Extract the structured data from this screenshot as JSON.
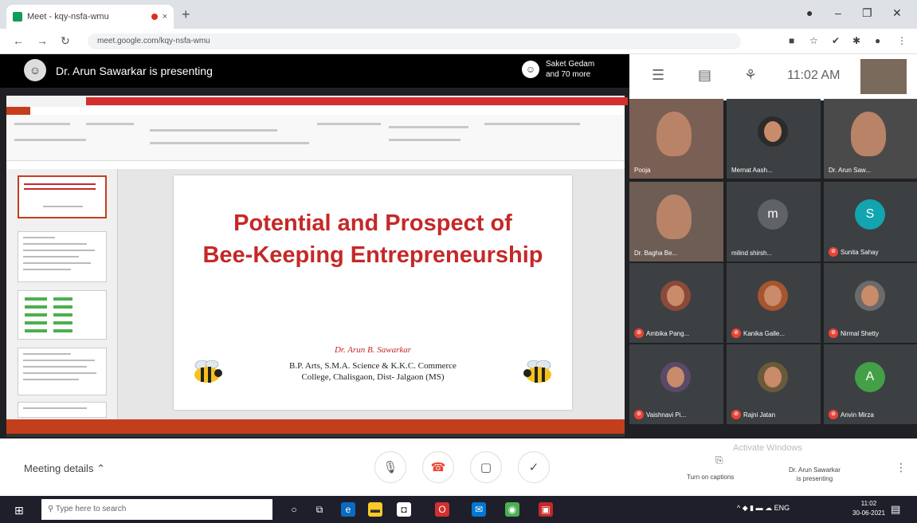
{
  "browser": {
    "tab_title": "Meet - kqy-nsfa-wmu",
    "url": "meet.google.com/kqy-nsfa-wmu",
    "new_tab": "+",
    "close_tab": "×"
  },
  "meet": {
    "presenting_text": "Dr. Arun Sawarkar is presenting",
    "viewers_line1": "Saket Gedam",
    "viewers_line2": "and 70 more",
    "time": "11:02 AM"
  },
  "slide": {
    "title_line1": "Potential and Prospect of",
    "title_line2": "Bee-Keeping Entrepreneurship",
    "author": "Dr. Arun B. Sawarkar",
    "college_line1": "B.P. Arts, S.M.A. Science & K.K.C. Commerce",
    "college_line2": "College, Chalisgaon, Dist- Jalgaon (MS)"
  },
  "participants": [
    {
      "name": "Pooja",
      "muted": false,
      "kind": "video",
      "color": "#7a5f55"
    },
    {
      "name": "Mernat Aash...",
      "muted": false,
      "kind": "photo",
      "color": "#2b2b2b"
    },
    {
      "name": "Dr. Arun Saw...",
      "muted": false,
      "kind": "video",
      "color": "#4a4a4a"
    },
    {
      "name": "Dr. Bagha Be...",
      "muted": false,
      "kind": "video",
      "color": "#6d5d55"
    },
    {
      "name": "milind shirsh...",
      "muted": false,
      "kind": "letter",
      "letter": "m",
      "color": "#5f6368"
    },
    {
      "name": "Sunita Sahay",
      "muted": true,
      "kind": "letter",
      "letter": "S",
      "color": "#12a4af"
    },
    {
      "name": "Ambika Pang...",
      "muted": true,
      "kind": "photo",
      "color": "#8a4a3a"
    },
    {
      "name": "Kanika Galle...",
      "muted": true,
      "kind": "photo",
      "color": "#a5552f"
    },
    {
      "name": "Nirmal Shetty",
      "muted": true,
      "kind": "photo",
      "color": "#6b6b6b"
    },
    {
      "name": "Vaishnavi Pi...",
      "muted": true,
      "kind": "photo",
      "color": "#5a4a6a"
    },
    {
      "name": "Rajni Jatan",
      "muted": true,
      "kind": "photo",
      "color": "#6a5a3a"
    },
    {
      "name": "Anvin Mirza",
      "muted": true,
      "kind": "letter",
      "letter": "A",
      "color": "#43a047"
    }
  ],
  "controls": {
    "meeting_details": "Meeting details",
    "captions_label": "Turn on captions",
    "presenting_label_1": "Dr. Arun Sawarkar",
    "presenting_label_2": "is presenting",
    "watermark": "Activate Windows"
  },
  "taskbar": {
    "search_placeholder": "Type here to search",
    "tray_text": "ENG",
    "time": "11:02",
    "date": "30-06-2021"
  },
  "colors": {
    "meet_bg": "#202124",
    "slide_title": "#c62828",
    "ppt_accent": "#c43e1c",
    "mic_off": "#ea4335"
  }
}
